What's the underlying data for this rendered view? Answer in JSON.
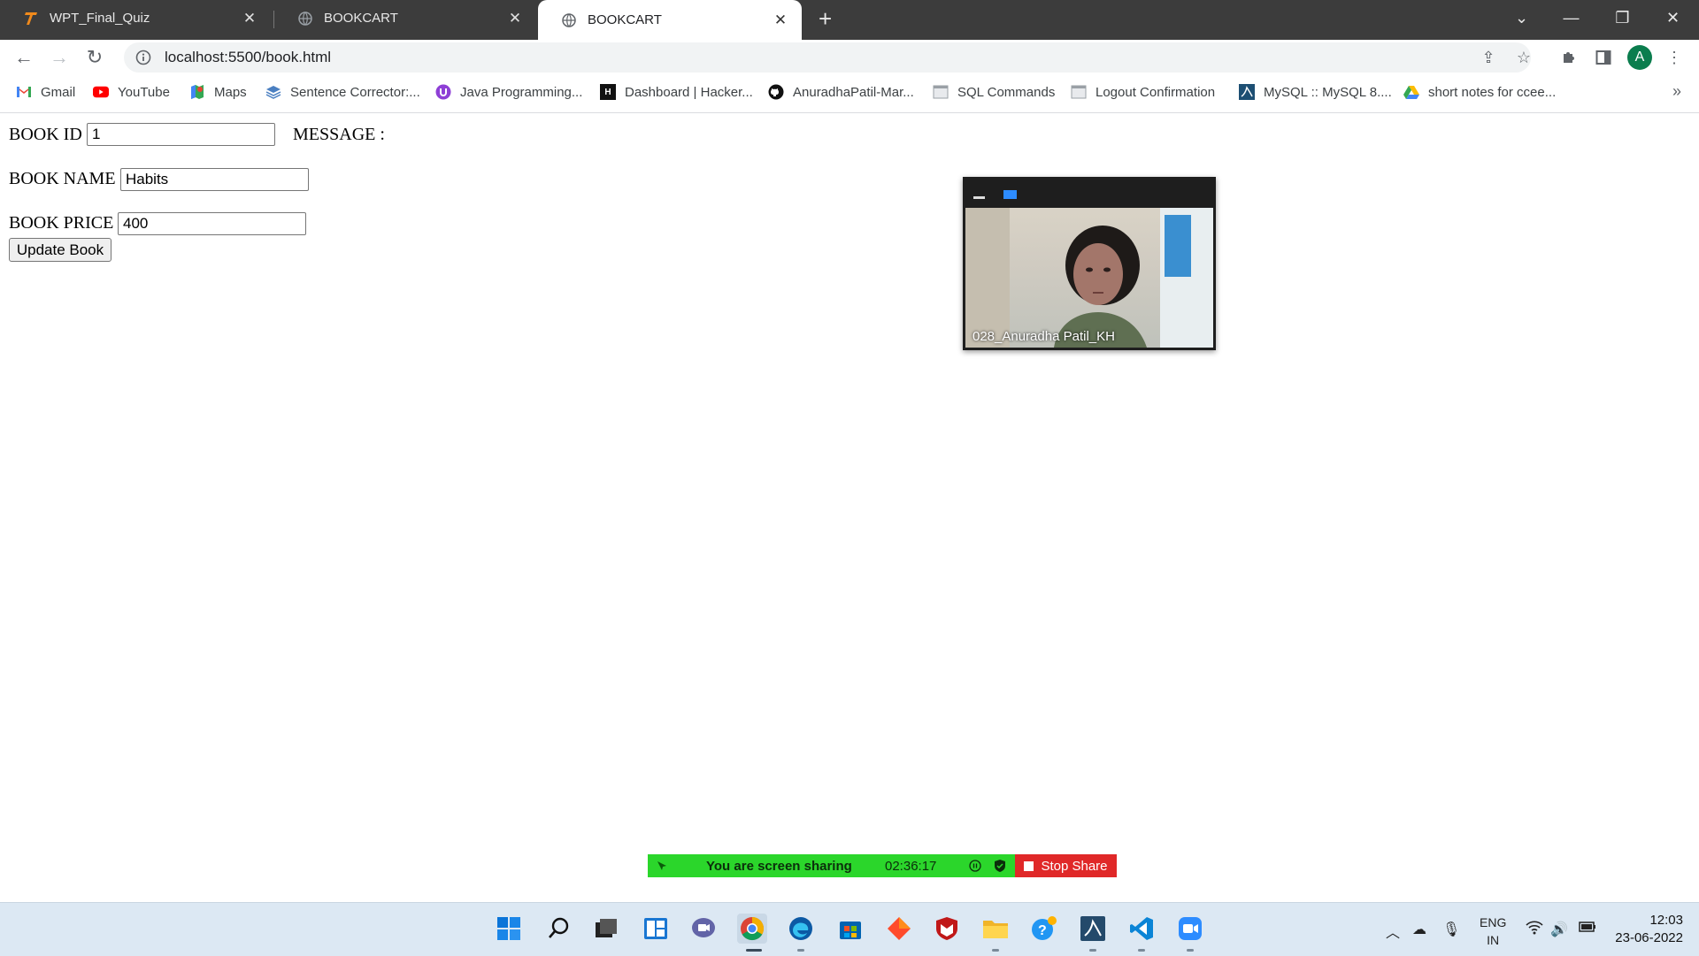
{
  "browser": {
    "tabs": [
      {
        "title": "WPT_Final_Quiz",
        "icon": "T-logo-icon",
        "active": false
      },
      {
        "title": "BOOKCART",
        "icon": "globe-icon",
        "active": false
      },
      {
        "title": "BOOKCART",
        "icon": "globe-icon",
        "active": true
      }
    ],
    "url": "localhost:5500/book.html",
    "profile_initial": "A",
    "bookmarks": [
      {
        "label": "Gmail",
        "icon": "gmail-icon"
      },
      {
        "label": "YouTube",
        "icon": "youtube-icon"
      },
      {
        "label": "Maps",
        "icon": "maps-icon"
      },
      {
        "label": "Sentence Corrector:...",
        "icon": "layers-icon"
      },
      {
        "label": "Java Programming...",
        "icon": "circle-u-icon"
      },
      {
        "label": "Dashboard | Hacker...",
        "icon": "hackerrank-icon"
      },
      {
        "label": "AnuradhaPatil-Mar...",
        "icon": "github-icon"
      },
      {
        "label": "SQL Commands",
        "icon": "page-icon"
      },
      {
        "label": "Logout Confirmation",
        "icon": "page-icon"
      },
      {
        "label": "MySQL :: MySQL 8....",
        "icon": "mysql-icon"
      },
      {
        "label": "short notes for ccee...",
        "icon": "drive-icon"
      }
    ]
  },
  "form": {
    "book_id_label": "BOOK ID",
    "book_id_value": "1",
    "message_label": "MESSAGE :",
    "book_name_label": "BOOK NAME",
    "book_name_value": "Habits",
    "book_price_label": "BOOK PRICE",
    "book_price_value": "400",
    "update_button": "Update Book"
  },
  "zoom": {
    "participant_name": "028_Anuradha Patil_KH",
    "sharing_text": "You are screen sharing",
    "elapsed": "02:36:17",
    "stop_label": "Stop Share"
  },
  "taskbar": {
    "lang_line1": "ENG",
    "lang_line2": "IN",
    "time": "12:03",
    "date": "23-06-2022"
  },
  "colors": {
    "tabbar": "#3c3c3c",
    "share_green": "#2bd62b",
    "stop_red": "#e02828",
    "zoom_blue": "#2d8cff"
  }
}
